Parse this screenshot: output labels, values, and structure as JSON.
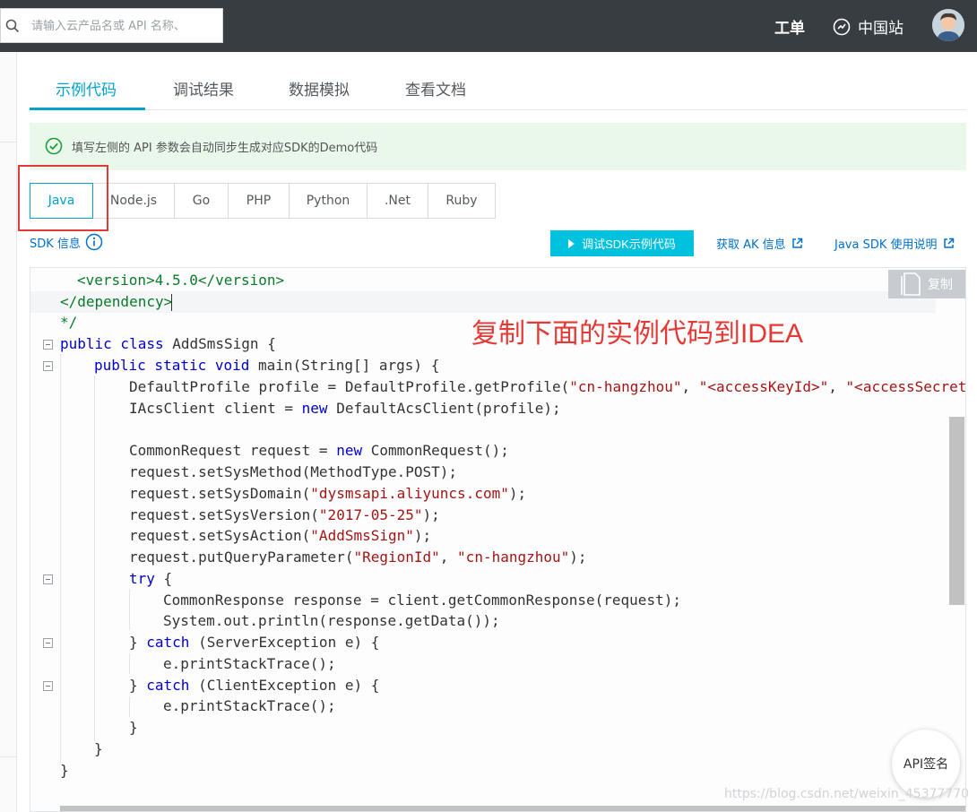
{
  "topbar": {
    "search_placeholder": "请输入云产品名或 API 名称、",
    "ticket": "工单",
    "region": "中国站"
  },
  "tabs": [
    "示例代码",
    "调试结果",
    "数据模拟",
    "查看文档"
  ],
  "info": {
    "text": "填写左侧的 API 参数会自动同步生成对应SDK的Demo代码"
  },
  "languages": [
    "Java",
    "Node.js",
    "Go",
    "PHP",
    "Python",
    ".Net",
    "Ruby"
  ],
  "active_language": "Java",
  "sdk": {
    "info_label": "SDK 信息",
    "debug_button": "调试SDK示例代码",
    "ak_link": "获取 AK 信息",
    "usage_link": "Java SDK 使用说明"
  },
  "editor": {
    "copy_label": "复制",
    "annotation": "复制下面的实例代码到IDEA"
  },
  "code": {
    "line1": "<version>4.5.0</version>",
    "line2": "</dependency>",
    "line3": "*/",
    "class_kw": "public class",
    "class_name": "AddSmsSign {",
    "main_kw": "public static void",
    "main_sig": "main(String[] args) {",
    "p1": "DefaultProfile profile = DefaultProfile.getProfile(",
    "p2": "\"cn-hangzhou\"",
    "p3": ", ",
    "p4": "\"<accessKeyId>\"",
    "p5": ", ",
    "p6": "\"<accessSecret>\"",
    "c1": "IAcsClient client = ",
    "c2": "new",
    "c3": " DefaultAcsClient(profile);",
    "r1": "CommonRequest request = ",
    "r2": "new",
    "r3": " CommonRequest();",
    "m1": "request.setSysMethod(MethodType.POST);",
    "d1": "request.setSysDomain(",
    "d2": "\"dysmsapi.aliyuncs.com\"",
    "d3": ");",
    "v1": "request.setSysVersion(",
    "v2": "\"2017-05-25\"",
    "v3": ");",
    "a1": "request.setSysAction(",
    "a2": "\"AddSmsSign\"",
    "a3": ");",
    "q1": "request.putQueryParameter(",
    "q2": "\"RegionId\"",
    "q3": ", ",
    "q4": "\"cn-hangzhou\"",
    "q5": ");",
    "try_kw": "try",
    "try_brace": " {",
    "resp": "CommonResponse response = client.getCommonResponse(request);",
    "print": "System.out.println(response.getData());",
    "close1": "} ",
    "catch_kw": "catch",
    "catch1": " (ServerException e) {",
    "trace": "e.printStackTrace();",
    "close2": "} ",
    "catch_kw2": "catch",
    "catch2": " (ClientException e) {",
    "trace2": "e.printStackTrace();",
    "brace1": "}",
    "brace2": "}",
    "brace3": "}"
  },
  "floating": {
    "api_sign": "API签名",
    "watermark": "https://blog.csdn.net/weixin_45377770"
  },
  "colors": {
    "accent": "#00a2ca",
    "button": "#00c1de",
    "annotation_red": "#e53935",
    "topbar": "#373d41"
  }
}
